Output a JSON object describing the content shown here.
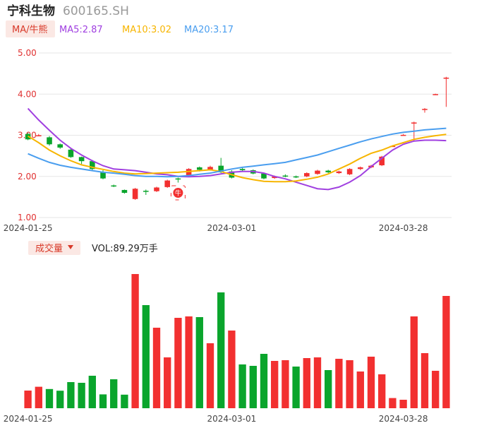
{
  "header": {
    "stock_name": "宁科生物",
    "stock_code": "600165.SH"
  },
  "ma_bar": {
    "label": "MA/牛熊",
    "ma5": "MA5:2.87",
    "ma10": "MA10:3.02",
    "ma20": "MA20:3.17"
  },
  "volume_bar": {
    "label": "成交量",
    "dropdown_icon": "caret-down-icon",
    "vol": "VOL:89.29万手"
  },
  "colors": {
    "up": "#f23030",
    "down": "#0aa52c",
    "ma5": "#a040e0",
    "ma10": "#f7b500",
    "ma20": "#4a9eef",
    "y_label": "#e03030",
    "grid": "#e6e6e6"
  },
  "chart_data": [
    {
      "type": "candlestick",
      "title": "",
      "ylim": [
        1.0,
        5.0
      ],
      "y_ticks": [
        "5.00",
        "4.00",
        "3.00",
        "2.00",
        "1.00"
      ],
      "x_tick_labels": [
        {
          "index": 0,
          "label": "2024-01-25"
        },
        {
          "index": 19,
          "label": "2024-03-01"
        },
        {
          "index": 35,
          "label": "2024-03-28"
        }
      ],
      "grid": true,
      "candles": [
        {
          "o": 3.03,
          "c": 2.9,
          "h": 3.06,
          "l": 2.88
        },
        {
          "o": 3.0,
          "c": 3.0,
          "h": 3.03,
          "l": 2.98
        },
        {
          "o": 2.95,
          "c": 2.78,
          "h": 2.98,
          "l": 2.75
        },
        {
          "o": 2.78,
          "c": 2.7,
          "h": 2.8,
          "l": 2.67
        },
        {
          "o": 2.65,
          "c": 2.47,
          "h": 2.67,
          "l": 2.45
        },
        {
          "o": 2.47,
          "c": 2.37,
          "h": 2.48,
          "l": 2.3
        },
        {
          "o": 2.37,
          "c": 2.18,
          "h": 2.4,
          "l": 2.15
        },
        {
          "o": 2.1,
          "c": 1.95,
          "h": 2.15,
          "l": 1.93
        },
        {
          "o": 1.78,
          "c": 1.76,
          "h": 1.8,
          "l": 1.74
        },
        {
          "o": 1.67,
          "c": 1.6,
          "h": 1.68,
          "l": 1.58
        },
        {
          "o": 1.45,
          "c": 1.7,
          "h": 1.72,
          "l": 1.43
        },
        {
          "o": 1.65,
          "c": 1.63,
          "h": 1.68,
          "l": 1.55
        },
        {
          "o": 1.64,
          "c": 1.73,
          "h": 1.75,
          "l": 1.62
        },
        {
          "o": 1.74,
          "c": 1.9,
          "h": 1.92,
          "l": 1.72
        },
        {
          "o": 1.95,
          "c": 1.93,
          "h": 1.97,
          "l": 1.85
        },
        {
          "o": 2.02,
          "c": 2.18,
          "h": 2.2,
          "l": 2.0
        },
        {
          "o": 2.22,
          "c": 2.16,
          "h": 2.24,
          "l": 2.12
        },
        {
          "o": 2.16,
          "c": 2.23,
          "h": 2.26,
          "l": 2.14
        },
        {
          "o": 2.26,
          "c": 2.1,
          "h": 2.45,
          "l": 2.08
        },
        {
          "o": 2.12,
          "c": 1.97,
          "h": 2.15,
          "l": 1.95
        },
        {
          "o": 2.18,
          "c": 2.15,
          "h": 2.22,
          "l": 2.12
        },
        {
          "o": 2.15,
          "c": 2.07,
          "h": 2.17,
          "l": 2.05
        },
        {
          "o": 2.07,
          "c": 1.95,
          "h": 2.08,
          "l": 1.93
        },
        {
          "o": 1.96,
          "c": 2.0,
          "h": 2.02,
          "l": 1.94
        },
        {
          "o": 2.02,
          "c": 2.0,
          "h": 2.05,
          "l": 1.98
        },
        {
          "o": 2.0,
          "c": 1.98,
          "h": 2.02,
          "l": 1.96
        },
        {
          "o": 2.0,
          "c": 2.08,
          "h": 2.1,
          "l": 1.98
        },
        {
          "o": 2.06,
          "c": 2.14,
          "h": 2.16,
          "l": 2.04
        },
        {
          "o": 2.14,
          "c": 2.1,
          "h": 2.16,
          "l": 2.08
        },
        {
          "o": 2.08,
          "c": 2.12,
          "h": 2.14,
          "l": 2.06
        },
        {
          "o": 2.05,
          "c": 2.18,
          "h": 2.2,
          "l": 2.03
        },
        {
          "o": 2.18,
          "c": 2.22,
          "h": 2.24,
          "l": 2.15
        },
        {
          "o": 2.22,
          "c": 2.26,
          "h": 2.28,
          "l": 2.2
        },
        {
          "o": 2.27,
          "c": 2.48,
          "h": 2.5,
          "l": 2.25
        },
        {
          "o": 2.74,
          "c": 2.74,
          "h": 2.76,
          "l": 2.72
        },
        {
          "o": 3.01,
          "c": 3.01,
          "h": 3.03,
          "l": 2.99
        },
        {
          "o": 3.31,
          "c": 3.31,
          "h": 3.33,
          "l": 2.85
        },
        {
          "o": 3.64,
          "c": 3.64,
          "h": 3.66,
          "l": 3.55
        },
        {
          "o": 4.0,
          "c": 4.0,
          "h": 4.01,
          "l": 3.99
        },
        {
          "o": 4.38,
          "c": 4.4,
          "h": 4.42,
          "l": 3.69
        }
      ],
      "series": [
        {
          "name": "MA5",
          "values": [
            3.65,
            3.37,
            3.12,
            2.88,
            2.68,
            2.52,
            2.38,
            2.26,
            2.18,
            2.16,
            2.14,
            2.1,
            2.06,
            2.04,
            2.0,
            1.99,
            2.0,
            2.02,
            2.06,
            2.1,
            2.12,
            2.12,
            2.08,
            2.0,
            1.94,
            1.86,
            1.78,
            1.7,
            1.68,
            1.74,
            1.86,
            2.02,
            2.24,
            2.44,
            2.64,
            2.78,
            2.86,
            2.88,
            2.88,
            2.87
          ]
        },
        {
          "name": "MA10",
          "values": [
            2.98,
            2.82,
            2.64,
            2.5,
            2.38,
            2.28,
            2.22,
            2.17,
            2.12,
            2.08,
            2.06,
            2.07,
            2.08,
            2.09,
            2.1,
            2.12,
            2.14,
            2.16,
            2.12,
            2.04,
            1.97,
            1.92,
            1.88,
            1.87,
            1.87,
            1.89,
            1.93,
            1.98,
            2.06,
            2.18,
            2.3,
            2.44,
            2.56,
            2.64,
            2.74,
            2.82,
            2.9,
            2.95,
            2.99,
            3.02
          ]
        },
        {
          "name": "MA20",
          "values": [
            2.55,
            2.44,
            2.34,
            2.27,
            2.22,
            2.18,
            2.14,
            2.1,
            2.08,
            2.05,
            2.02,
            2.0,
            2.0,
            1.99,
            2.0,
            2.02,
            2.05,
            2.08,
            2.13,
            2.18,
            2.22,
            2.25,
            2.28,
            2.31,
            2.34,
            2.4,
            2.46,
            2.52,
            2.6,
            2.68,
            2.76,
            2.84,
            2.91,
            2.97,
            3.03,
            3.07,
            3.1,
            3.13,
            3.15,
            3.17
          ]
        }
      ],
      "marker": {
        "index": 14,
        "icon": "bull-badge-icon",
        "text": "牛"
      }
    },
    {
      "type": "bar",
      "title": "",
      "unit": "万手",
      "x_tick_labels": [
        {
          "index": 0,
          "label": "2024-01-25"
        },
        {
          "index": 19,
          "label": "2024-03-01"
        },
        {
          "index": 35,
          "label": "2024-03-28"
        }
      ],
      "values": [
        12.5,
        15.2,
        13.6,
        12.4,
        18.5,
        18.0,
        23.0,
        9.8,
        20.5,
        9.6,
        95.0,
        73.0,
        57.0,
        36.0,
        64.0,
        65.0,
        64.5,
        46.0,
        82.0,
        55.0,
        31.0,
        30.0,
        38.5,
        33.5,
        34.0,
        29.5,
        35.5,
        36.0,
        27.0,
        35.0,
        34.0,
        26.0,
        36.5,
        24.0,
        7.2,
        6.0,
        65.0,
        39.0,
        26.5,
        79.5
      ],
      "colors_by_bar": [
        "up",
        "up",
        "down",
        "down",
        "down",
        "down",
        "down",
        "down",
        "down",
        "down",
        "up",
        "down",
        "up",
        "up",
        "up",
        "up",
        "down",
        "up",
        "down",
        "up",
        "down",
        "down",
        "down",
        "up",
        "up",
        "down",
        "up",
        "up",
        "down",
        "up",
        "up",
        "up",
        "up",
        "up",
        "up",
        "up",
        "up",
        "up",
        "up",
        "up"
      ]
    }
  ]
}
